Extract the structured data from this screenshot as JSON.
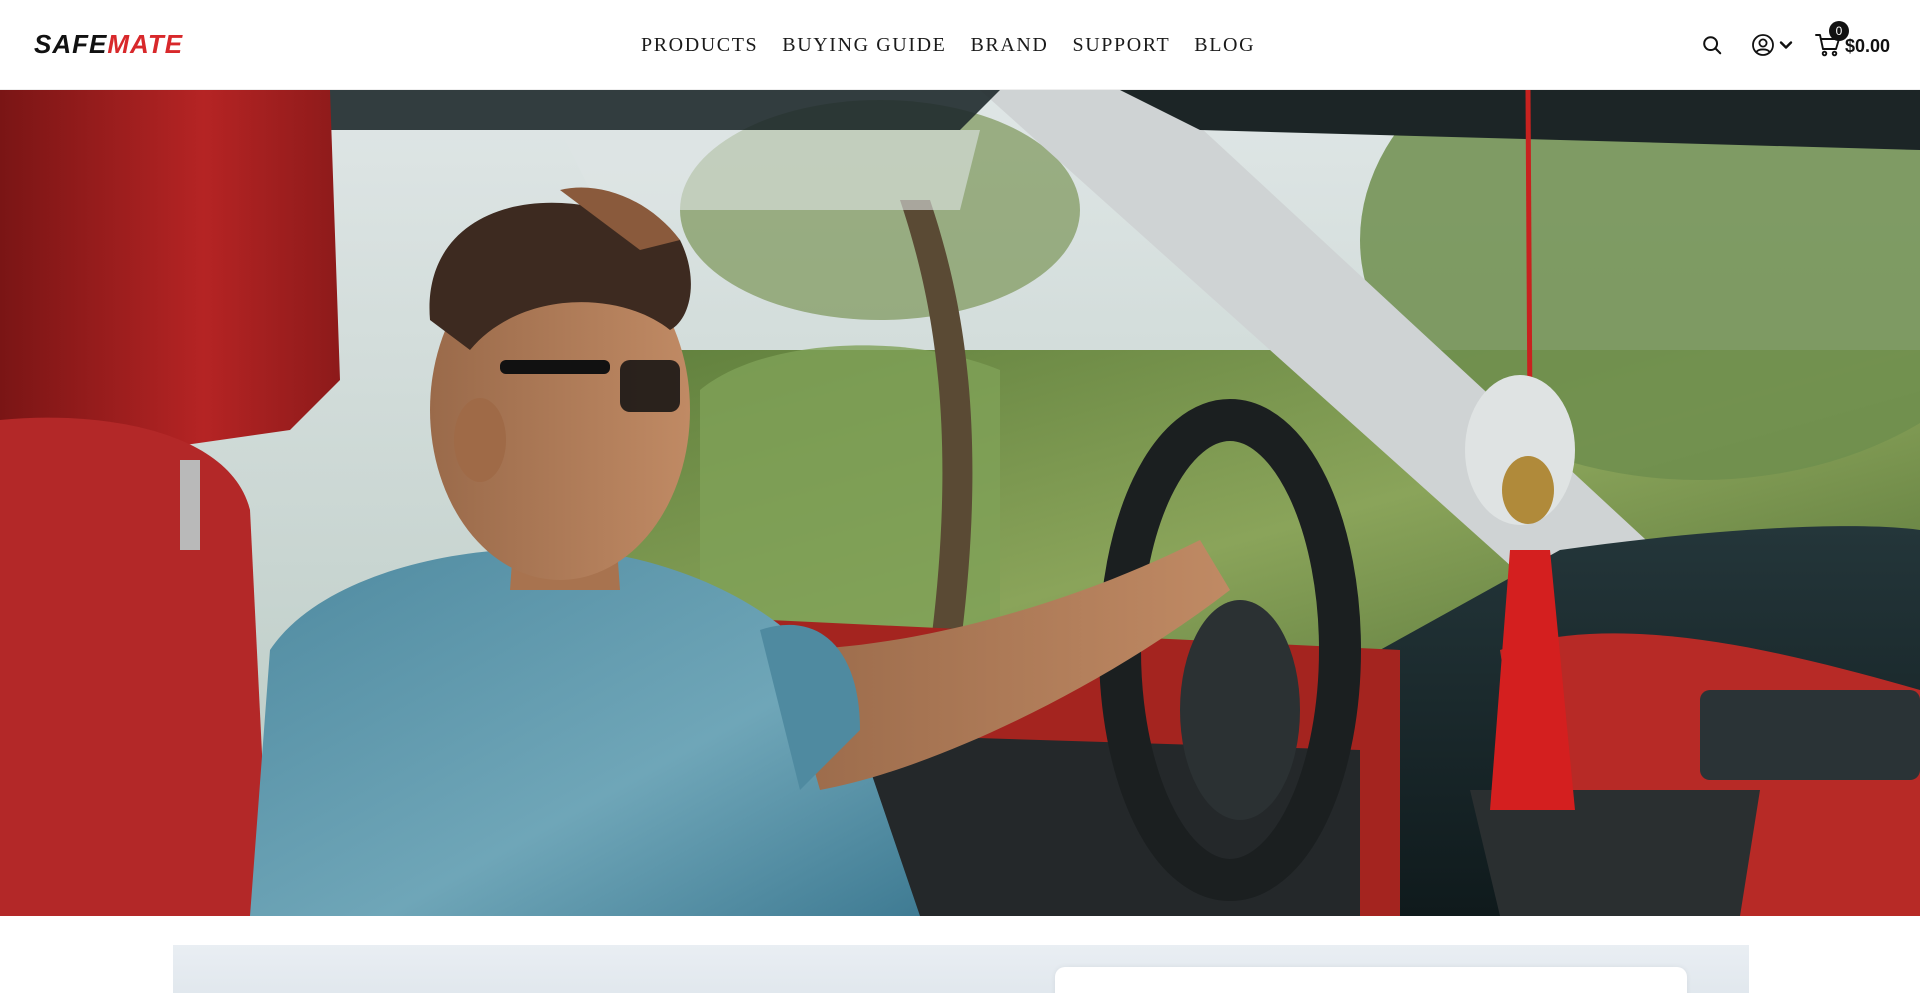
{
  "brand": {
    "logo_part1": "SAFE",
    "logo_part2": "MATE",
    "logo_colors": {
      "part1": "#111111",
      "part2": "#d8282b"
    }
  },
  "nav": {
    "items": [
      {
        "label": "PRODUCTS"
      },
      {
        "label": "BUYING GUIDE"
      },
      {
        "label": "BRAND"
      },
      {
        "label": "SUPPORT"
      },
      {
        "label": "BLOG"
      }
    ]
  },
  "header_actions": {
    "search_icon": "search-icon",
    "account_icon": "user-circle-icon",
    "account_menu_icon": "chevron-down-icon",
    "cart_icon": "cart-icon",
    "cart_count": "0",
    "cart_total": "$0.00"
  },
  "hero": {
    "image": "man driving car with red leather interior"
  },
  "colors": {
    "accent": "#d8282b",
    "text": "#1a1a1a",
    "background": "#ffffff"
  }
}
